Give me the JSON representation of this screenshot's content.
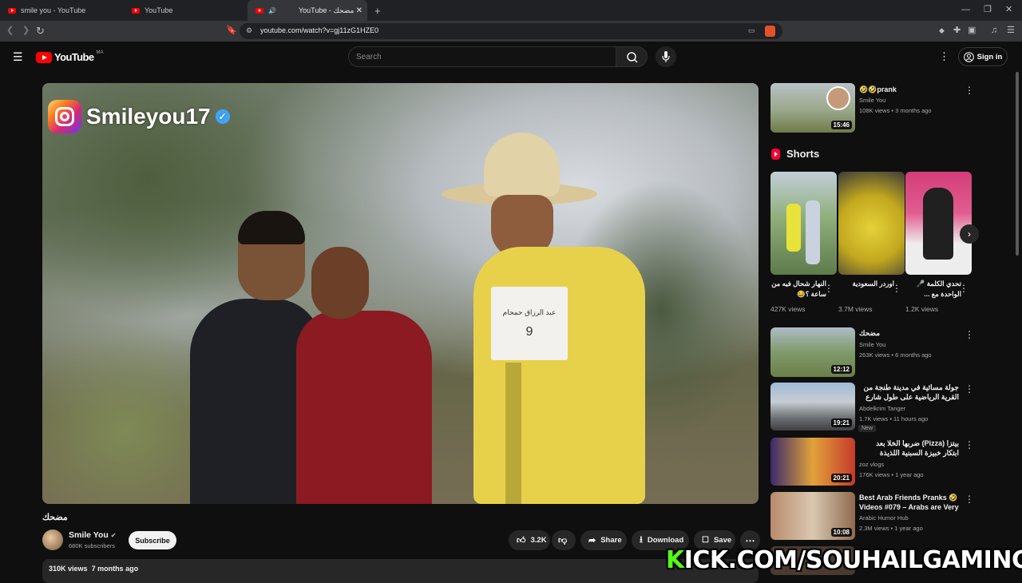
{
  "browser": {
    "tabs": [
      {
        "label": "smile you - YouTube"
      },
      {
        "label": "YouTube"
      },
      {
        "label": "YouTube - مضحك"
      }
    ],
    "url": "youtube.com/watch?v=gj11zG1HZE0"
  },
  "header": {
    "logo_text": "YouTube",
    "region": "MA",
    "search_placeholder": "Search",
    "signin_label": "Sign in"
  },
  "video": {
    "watermark": "Smileyou17",
    "bib_text": "عبد الرزاق حمحام",
    "bib_number": "9",
    "title": "مضحك",
    "channel": "Smile You",
    "subscribers": "680K subscribers",
    "subscribe_label": "Subscribe",
    "likes": "3.2K",
    "share_label": "Share",
    "download_label": "Download",
    "save_label": "Save",
    "views": "310K views",
    "age": "7 months ago"
  },
  "sidebar": {
    "first": {
      "title": "🤣🤣prank",
      "channel": "Smile You",
      "meta": "108K views • 3 months ago",
      "duration": "15:46"
    },
    "shorts_label": "Shorts",
    "shorts": [
      {
        "title": "النهار شحال فيه من ساعة ؟😂",
        "views": "427K views"
      },
      {
        "title": "اوردر السعودية",
        "views": "3.7M views"
      },
      {
        "title": "تحدي الكلمة 🎤 الواحدة مع ...",
        "views": "1.2K views"
      }
    ],
    "videos": [
      {
        "title": "مضحك",
        "channel": "Smile You",
        "meta": "263K views • 6 months ago",
        "duration": "12:12"
      },
      {
        "title": "جولة مسائية في مدينة طنجة من القرية الرياضية على طول شارع مولاي رشيد",
        "channel": "Abdelkrim Tanger",
        "meta": "1.7K views • 11 hours ago",
        "duration": "19:21",
        "badge": "New"
      },
      {
        "title": "بيتزا (Pizza) ضربها الخلا بعد ابتكار خبيزة السبنية اللذيذة الجديدة",
        "channel": "zoz vlogs",
        "meta": "176K views • 1 year ago",
        "duration": "20:21"
      },
      {
        "title": "Best Arab Friends Pranks 🤣 Videos #079 – Arabs are Very ...",
        "channel": "Arabic Humor Hub",
        "meta": "2.3M views • 1 year ago",
        "duration": "10:08"
      }
    ]
  },
  "overlay": {
    "kick_first": "K",
    "kick_rest": "ICK.COM/SOUHAILGAMING"
  }
}
